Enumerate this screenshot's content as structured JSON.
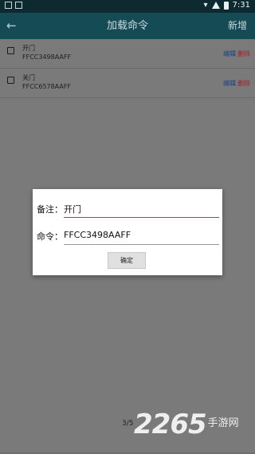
{
  "status_bar": {
    "time": "7:31"
  },
  "app_bar": {
    "back_icon": "←",
    "title": "加载命令",
    "add_label": "新增"
  },
  "commands": [
    {
      "name": "开门",
      "code": "FFCC3498AAFF",
      "edit_label": "编辑",
      "delete_label": "删除",
      "checked": false
    },
    {
      "name": "关门",
      "code": "FFCC6578AAFF",
      "edit_label": "编辑",
      "delete_label": "删除",
      "checked": false
    }
  ],
  "dialog": {
    "note_label": "备注：",
    "note_value": "开门",
    "command_label": "命令：",
    "command_value": "FFCC3498AAFF",
    "confirm_label": "确定"
  },
  "pager": {
    "text": "3/5"
  },
  "watermark": {
    "number": "2265",
    "site": "手游网"
  }
}
